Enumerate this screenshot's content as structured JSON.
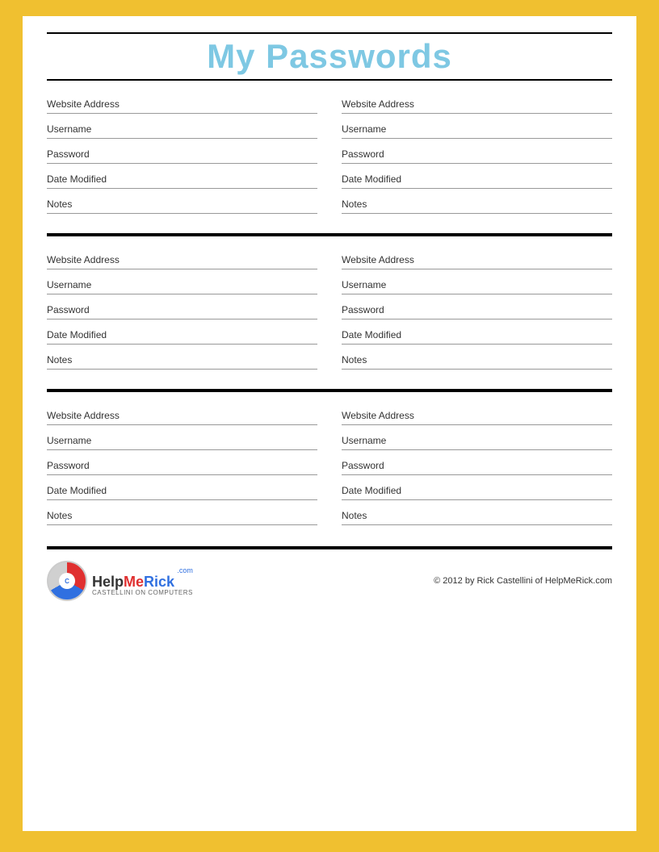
{
  "title": "My Passwords",
  "topLine": true,
  "sections": [
    {
      "id": 1,
      "entries": [
        {
          "fields": [
            {
              "label": "Website Address"
            },
            {
              "label": "Username"
            },
            {
              "label": "Password"
            },
            {
              "label": "Date Modified"
            },
            {
              "label": "Notes"
            }
          ]
        },
        {
          "fields": [
            {
              "label": "Website Address"
            },
            {
              "label": "Username"
            },
            {
              "label": "Password"
            },
            {
              "label": "Date Modified"
            },
            {
              "label": "Notes"
            }
          ]
        }
      ]
    },
    {
      "id": 2,
      "entries": [
        {
          "fields": [
            {
              "label": "Website Address"
            },
            {
              "label": "Username"
            },
            {
              "label": "Password"
            },
            {
              "label": "Date Modified"
            },
            {
              "label": "Notes"
            }
          ]
        },
        {
          "fields": [
            {
              "label": "Website Address"
            },
            {
              "label": "Username"
            },
            {
              "label": "Password"
            },
            {
              "label": "Date Modified"
            },
            {
              "label": "Notes"
            }
          ]
        }
      ]
    },
    {
      "id": 3,
      "entries": [
        {
          "fields": [
            {
              "label": "Website Address"
            },
            {
              "label": "Username"
            },
            {
              "label": "Password"
            },
            {
              "label": "Date Modified"
            },
            {
              "label": "Notes"
            }
          ]
        },
        {
          "fields": [
            {
              "label": "Website Address"
            },
            {
              "label": "Username"
            },
            {
              "label": "Password"
            },
            {
              "label": "Date Modified"
            },
            {
              "label": "Notes"
            }
          ]
        }
      ]
    }
  ],
  "footer": {
    "logo": {
      "com": ".com",
      "main": "HelpMeRick",
      "sub": "CASTELLINI ON COMPUTERS"
    },
    "copyright": "© 2012 by Rick Castellini of HelpMeRick.com"
  }
}
